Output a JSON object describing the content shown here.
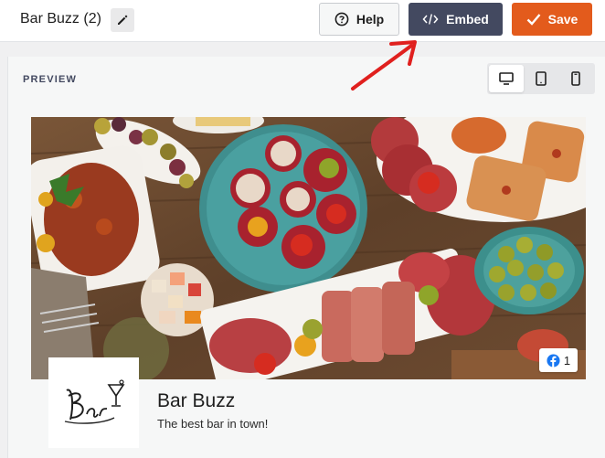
{
  "header": {
    "title": "Bar Buzz (2)",
    "help_label": "Help",
    "embed_label": "Embed",
    "save_label": "Save"
  },
  "preview": {
    "label": "PREVIEW",
    "devices": [
      "desktop-icon",
      "tablet-icon",
      "mobile-icon"
    ],
    "active_device": "desktop"
  },
  "page": {
    "name": "Bar Buzz",
    "tagline": "The best bar in town!",
    "facebook_count": "1",
    "logo_text": "Bar"
  },
  "colors": {
    "embed": "#434960",
    "save": "#e35b1c",
    "annotation_arrow": "#e0201e"
  }
}
